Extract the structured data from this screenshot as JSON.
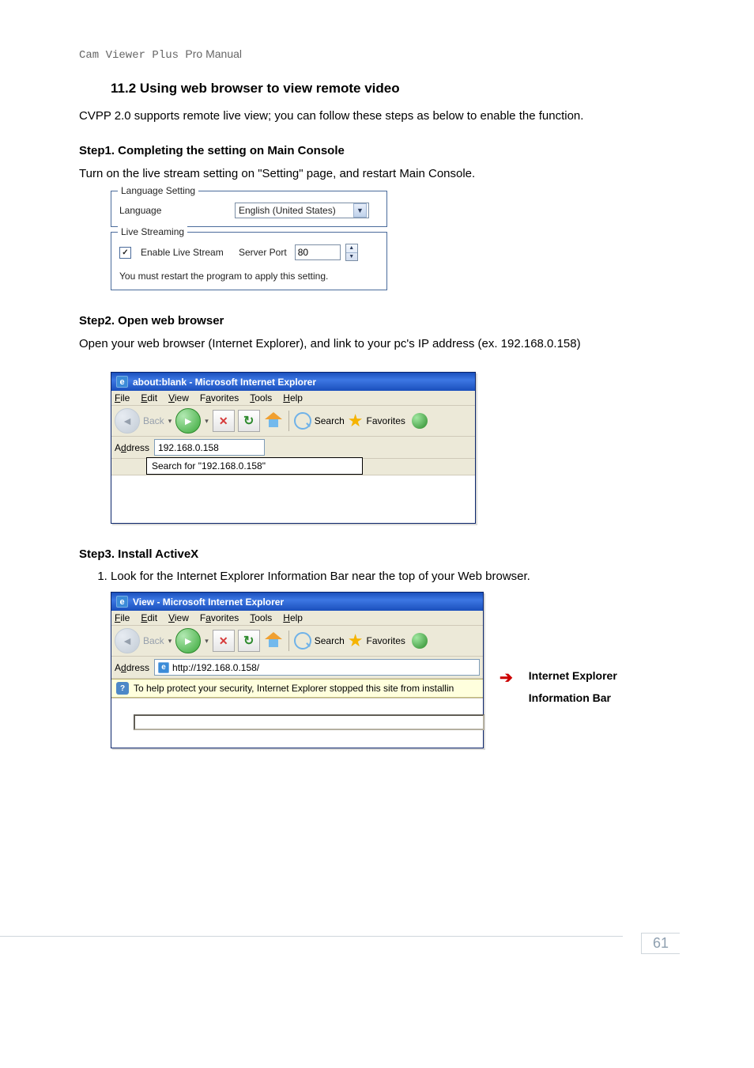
{
  "header": {
    "prefix": "Cam Viewer Plus ",
    "suffix": "Pro Manual"
  },
  "section": {
    "title": "11.2 Using web browser to view remote video",
    "intro": "CVPP 2.0 supports remote live view; you can follow these steps as below to enable the function."
  },
  "step1": {
    "heading": "Step1. Completing the setting on Main Console",
    "body": "Turn on the live stream setting on \"Setting\" page, and restart Main Console.",
    "group_lang": {
      "legend": "Language Setting",
      "label": "Language",
      "value": "English (United States)"
    },
    "group_stream": {
      "legend": "Live Streaming",
      "check_label": "Enable Live Stream",
      "checked": true,
      "port_label": "Server Port",
      "port_value": "80",
      "note": "You must restart the program to apply this setting."
    }
  },
  "step2": {
    "heading": "Step2. Open web browser",
    "body": "Open your web browser (Internet Explorer), and link to your pc's IP address (ex. 192.168.0.158)",
    "ie": {
      "title": "about:blank - Microsoft Internet Explorer",
      "menus": {
        "file": "File",
        "edit": "Edit",
        "view": "View",
        "favorites": "Favorites",
        "tools": "Tools",
        "help": "Help"
      },
      "back_label": "Back",
      "search_label": "Search",
      "favorites_label": "Favorites",
      "address_label": "Address",
      "address_value": "192.168.0.158",
      "suggest": "Search for \"192.168.0.158\""
    }
  },
  "step3": {
    "heading": "Step3. Install ActiveX",
    "list_item": "Look for the Internet Explorer Information Bar near the top of your Web browser.",
    "ie": {
      "title": "View - Microsoft Internet Explorer",
      "menus": {
        "file": "File",
        "edit": "Edit",
        "view": "View",
        "favorites": "Favorites",
        "tools": "Tools",
        "help": "Help"
      },
      "back_label": "Back",
      "search_label": "Search",
      "favorites_label": "Favorites",
      "address_label": "Address",
      "address_value": "http://192.168.0.158/",
      "infobar": "To help protect your security, Internet Explorer stopped this site from installin"
    },
    "callout": "Internet Explorer Information Bar"
  },
  "page_number": "61"
}
